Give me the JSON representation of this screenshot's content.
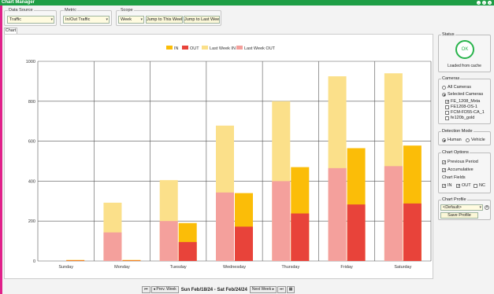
{
  "window": {
    "title": "Chart Manager"
  },
  "toolbar": {
    "data_source_label": "Data Source",
    "data_source_value": "Traffic",
    "metric_label": "Metric",
    "metric_value": "In/Out Traffic",
    "scope_label": "Scope",
    "scope_value": "Week",
    "jump_this_week": "Jump to This Week",
    "jump_last_week": "Jump to Last Week"
  },
  "tab": {
    "label": "Chart"
  },
  "navigation": {
    "first": "⏮",
    "prev": "◂ Prev. Week",
    "range": "Sun Feb/18/24 - Sat Feb/24/24",
    "next": "Next Week ▸",
    "last": "⏭",
    "calendar": "▦"
  },
  "status": {
    "label": "Status",
    "ring_text": "OK",
    "message": "Loaded from cache"
  },
  "cameras": {
    "label": "Cameras",
    "all": "All Cameras",
    "selected": "Selected Cameras",
    "items": [
      {
        "name": "FE_1208_Mxta",
        "checked": true
      },
      {
        "name": "FE1208-OS-1",
        "checked": false
      },
      {
        "name": "FCM-FD55-CA_1",
        "checked": false
      },
      {
        "name": "fe120b_gold",
        "checked": false
      }
    ]
  },
  "detection": {
    "label": "Detection Mode",
    "human": "Human",
    "vehicle": "Vehicle"
  },
  "options": {
    "label": "Chart Options",
    "previous_period": "Previous Period",
    "accumulative": "Accumulative",
    "fields_label": "Chart Fields",
    "in": "IN",
    "out": "OUT",
    "nc": "NC"
  },
  "profile": {
    "label": "Chart Profile",
    "value": "<Default>",
    "save": "Save Profile"
  },
  "colors": {
    "in": "#fbbd08",
    "out": "#e8433a",
    "last_in": "#fbe08a",
    "last_out": "#f4a09c",
    "accent": "#28b34b"
  },
  "chart_data": {
    "type": "bar",
    "categories": [
      "Sunday",
      "Monday",
      "Tuesday",
      "Wednesday",
      "Thursday",
      "Friday",
      "Saturday"
    ],
    "ylim": [
      0,
      1000
    ],
    "yticks": [
      0,
      200,
      400,
      600,
      800,
      1000
    ],
    "legend": [
      "IN",
      "OUT",
      "Last Week IN",
      "Last Week OUT"
    ],
    "legend_position": "top-center",
    "series": [
      {
        "name": "IN",
        "values": [
          5,
          5,
          190,
          340,
          470,
          565,
          578
        ]
      },
      {
        "name": "OUT",
        "values": [
          2,
          2,
          95,
          172,
          238,
          283,
          288
        ]
      },
      {
        "name": "Last Week IN",
        "values": [
          0,
          292,
          405,
          678,
          800,
          925,
          940
        ]
      },
      {
        "name": "Last Week OUT",
        "values": [
          0,
          143,
          200,
          343,
          400,
          465,
          475
        ]
      }
    ],
    "grid": true
  }
}
